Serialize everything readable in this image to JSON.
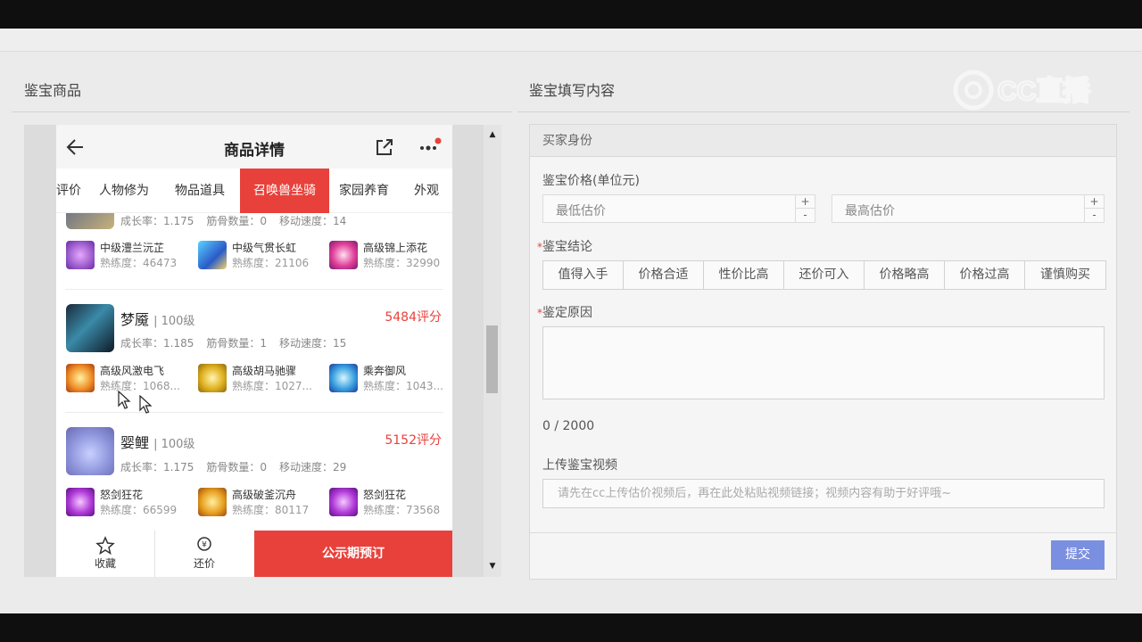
{
  "left_panel": {
    "title": "鉴宝商品"
  },
  "right_panel": {
    "title": "鉴宝填写内容"
  },
  "watermark": {
    "text": "CC直播"
  },
  "phone": {
    "title": "商品详情",
    "tabs": [
      "评价",
      "人物修为",
      "物品道具",
      "召唤兽坐骑",
      "家园养育",
      "外观"
    ],
    "active_tab": "召唤兽坐骑",
    "pets": [
      {
        "stats": [
          "成长率：1.175",
          "筋骨数量：0",
          "移动速度：14"
        ],
        "skills": [
          {
            "name": "中级澧兰沅芷",
            "prof": "熟练度：46473"
          },
          {
            "name": "中级气贯长虹",
            "prof": "熟练度：21106"
          },
          {
            "name": "高级锦上添花",
            "prof": "熟练度：32990"
          }
        ]
      },
      {
        "name": "梦魇",
        "level": "| 100级",
        "score": "5484评分",
        "stats": [
          "成长率：1.185",
          "筋骨数量：1",
          "移动速度：15"
        ],
        "skills": [
          {
            "name": "高级风激电飞",
            "prof": "熟练度：1068..."
          },
          {
            "name": "高级胡马驰骤",
            "prof": "熟练度：1027..."
          },
          {
            "name": "乘奔御风",
            "prof": "熟练度：1043..."
          }
        ]
      },
      {
        "name": "婴鲤",
        "level": "| 100级",
        "score": "5152评分",
        "stats": [
          "成长率：1.175",
          "筋骨数量：0",
          "移动速度：29"
        ],
        "skills": [
          {
            "name": "怒剑狂花",
            "prof": "熟练度：66599"
          },
          {
            "name": "高级破釜沉舟",
            "prof": "熟练度：80117"
          },
          {
            "name": "怒剑狂花",
            "prof": "熟练度：73568"
          }
        ]
      }
    ],
    "bottom": {
      "fav": "收藏",
      "bargain": "还价",
      "buy": "公示期预订"
    }
  },
  "form": {
    "section": "买家身份",
    "price_label": "鉴宝价格(单位元)",
    "min_placeholder": "最低估价",
    "max_placeholder": "最高估价",
    "conclusion_label": "鉴宝结论",
    "conclusions": [
      "值得入手",
      "价格合适",
      "性价比高",
      "还价可入",
      "价格略高",
      "价格过高",
      "谨慎购买"
    ],
    "reason_label": "鉴定原因",
    "counter": "0 / 2000",
    "video_label": "上传鉴宝视频",
    "video_placeholder": "请先在cc上传估价视频后，再在此处粘贴视频链接；视频内容有助于好评哦~",
    "submit": "提交"
  }
}
